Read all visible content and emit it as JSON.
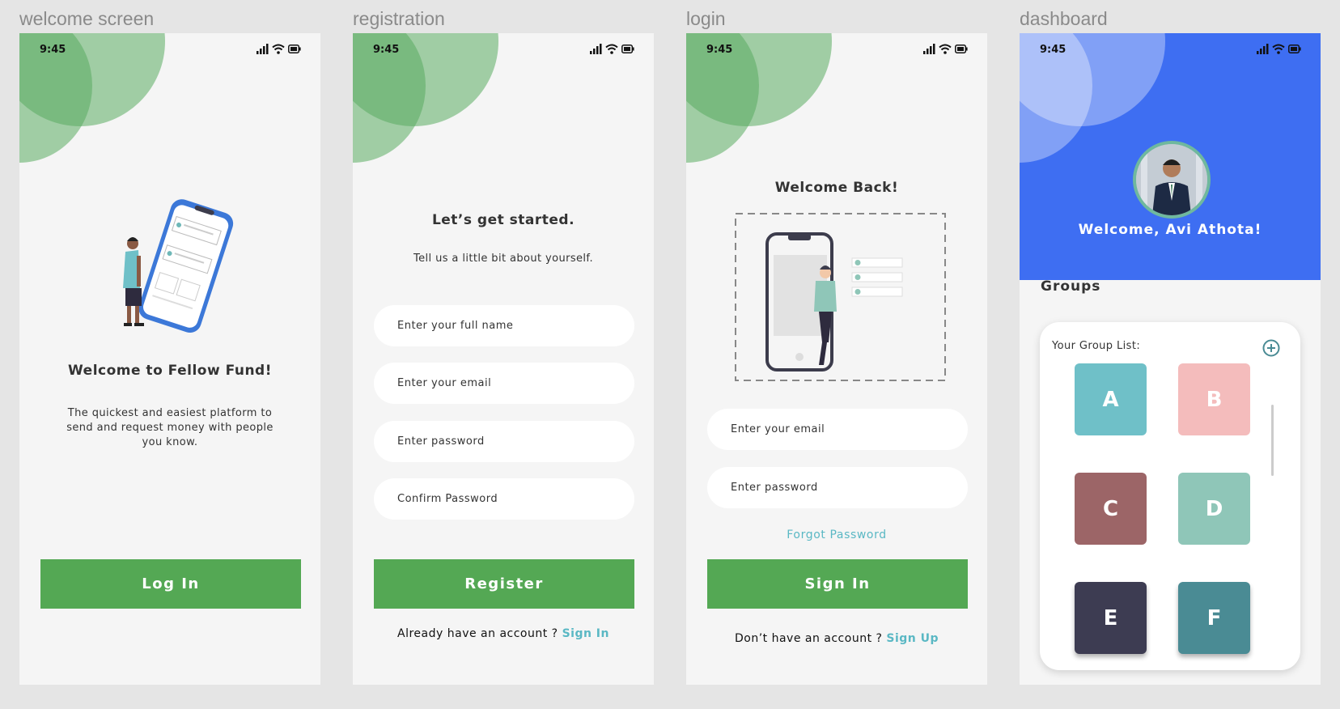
{
  "labels": {
    "welcome": "welcome screen",
    "registration": "registration",
    "login": "login",
    "dashboard": "dashboard"
  },
  "status": {
    "time": "9:45"
  },
  "welcome": {
    "title": "Welcome to Fellow Fund!",
    "description": "The quickest and easiest platform to send and request money with people you know.",
    "login_button": "Log In"
  },
  "registration": {
    "title": "Let’s get started.",
    "subtitle": "Tell us a little bit about yourself.",
    "fields": {
      "full_name": "Enter your full name",
      "email": "Enter your email",
      "password": "Enter password",
      "confirm": "Confirm Password"
    },
    "register_button": "Register",
    "footer_text": "Already have an account ? ",
    "footer_link": "Sign In"
  },
  "login": {
    "title": "Welcome Back!",
    "fields": {
      "email": "Enter your email",
      "password": "Enter password"
    },
    "forgot": "Forgot Password",
    "signin_button": "Sign In",
    "footer_text": "Don’t have an account ? ",
    "footer_link": "Sign Up"
  },
  "dashboard": {
    "welcome": "Welcome, Avi Athota!",
    "groups_heading": "Groups",
    "group_list_label": "Your Group List:",
    "groups": [
      {
        "letter": "A",
        "color": "#6fc0c8"
      },
      {
        "letter": "B",
        "color": "#f4bcbc"
      },
      {
        "letter": "C",
        "color": "#9c6567"
      },
      {
        "letter": "D",
        "color": "#8fc6b8"
      },
      {
        "letter": "E",
        "color": "#3d3c52"
      },
      {
        "letter": "F",
        "color": "#4a8b94"
      }
    ]
  },
  "colors": {
    "accent_green": "#54a854",
    "dashboard_blue": "#3e6ef2",
    "link_teal": "#5ab8c4"
  }
}
